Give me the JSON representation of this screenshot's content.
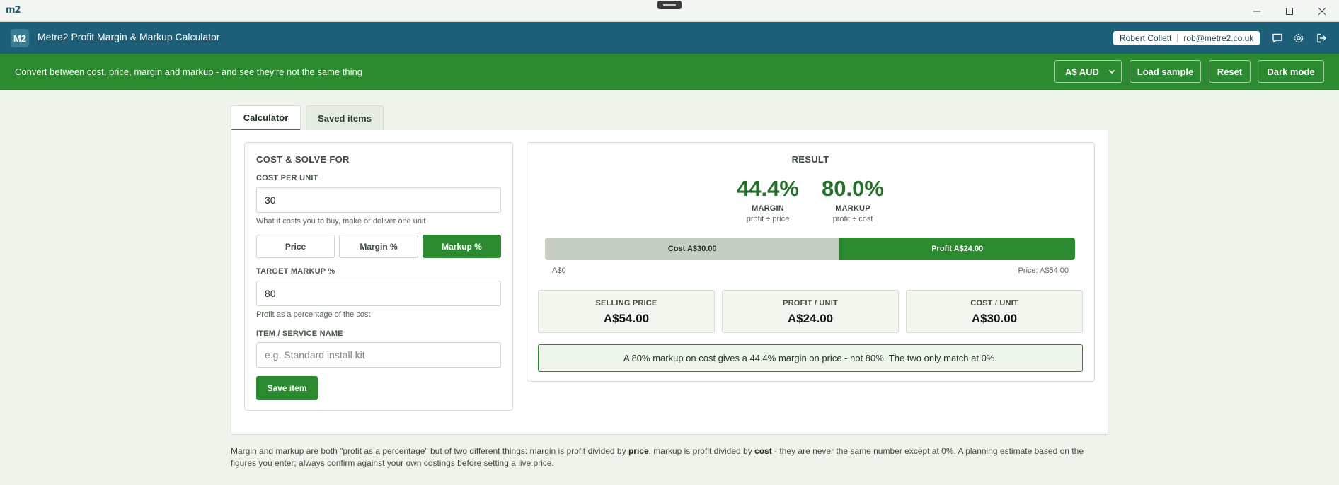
{
  "titlebar": {
    "logo": "m2",
    "icons": {
      "minimize": "minimize-icon",
      "maximize": "maximize-icon",
      "close": "close-icon"
    }
  },
  "header": {
    "badge": "M2",
    "title": "Metre2 Profit Margin & Markup Calculator",
    "user_name": "Robert Collett",
    "user_email": "rob@metre2.co.uk",
    "icons": [
      "chat-icon",
      "gear-icon",
      "logout-icon"
    ]
  },
  "banner": {
    "text": "Convert between cost, price, margin and markup - and see they're not the same thing",
    "currency": "A$ AUD",
    "load_sample": "Load sample",
    "reset": "Reset",
    "dark_mode": "Dark mode"
  },
  "tabs": [
    {
      "label": "Calculator",
      "active": true
    },
    {
      "label": "Saved items",
      "active": false
    }
  ],
  "form": {
    "section_title": "COST & SOLVE FOR",
    "cost_label": "COST PER UNIT",
    "cost_value": "30",
    "cost_help": "What it costs you to buy, make or deliver one unit",
    "solve_options": [
      "Price",
      "Margin %",
      "Markup %"
    ],
    "solve_selected": "Markup %",
    "target_label": "TARGET MARKUP %",
    "target_value": "80",
    "target_help": "Profit as a percentage of the cost",
    "item_label": "ITEM / SERVICE NAME",
    "item_placeholder": "e.g. Standard install kit",
    "save_button": "Save item"
  },
  "result": {
    "title": "RESULT",
    "margin_value": "44.4%",
    "margin_label": "MARGIN",
    "margin_formula": "profit ÷ price",
    "markup_value": "80.0%",
    "markup_label": "MARKUP",
    "markup_formula": "profit ÷ cost",
    "bar": {
      "cost_label": "Cost A$30.00",
      "profit_label": "Profit A$24.00",
      "cost_share": 0.556,
      "profit_share": 0.444,
      "axis_min": "A$0",
      "axis_max": "Price: A$54.00"
    },
    "stats": [
      {
        "label": "SELLING PRICE",
        "value": "A$54.00"
      },
      {
        "label": "PROFIT / UNIT",
        "value": "A$24.00"
      },
      {
        "label": "COST / UNIT",
        "value": "A$30.00"
      }
    ],
    "note": "A 80% markup on cost gives a 44.4% margin on price - not 80%. The two only match at 0%."
  },
  "footer": {
    "part1": "Margin and markup are both \"profit as a percentage\" but of two different things: margin is profit divided by ",
    "bold1": "price",
    "part2": ", markup is profit divided by ",
    "bold2": "cost",
    "part3": " - they are never the same number except at 0%. A planning estimate based on the figures you enter; always confirm against your own costings before setting a live price."
  },
  "colors": {
    "header_bg": "#1d5f78",
    "accent_green": "#2b8a30",
    "page_bg": "#eef3ec",
    "cost_bar": "#c6cec3"
  }
}
